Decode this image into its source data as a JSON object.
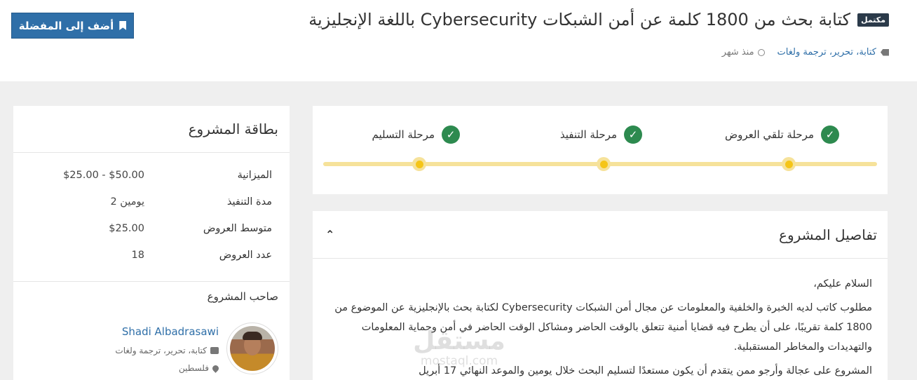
{
  "header": {
    "favorite_label": "أضف إلى المفضلة",
    "status": "مكتمل",
    "title": "كتابة بحث من 1800 كلمة عن أمن الشبكات Cybersecurity باللغة الإنجليزية",
    "categories": "كتابة، تحرير، ترجمة ولغات",
    "time": "منذ شهر"
  },
  "stages": [
    {
      "label": "مرحلة تلقي العروض"
    },
    {
      "label": "مرحلة التنفيذ"
    },
    {
      "label": "مرحلة التسليم"
    }
  ],
  "details": {
    "title": "تفاصيل المشروع",
    "paragraphs": [
      "السلام عليكم،",
      "مطلوب كاتب لديه الخبرة والخلفية والمعلومات عن مجال أمن الشبكات Cybersecurity لكتابة بحث بالإنجليزية عن الموضوع من 1800 كلمة تقريبًا، على أن يطرح فيه قضايا أمنية تتعلق بالوقت الحاضر ومشاكل الوقت الحاضر في أمن وحماية المعلومات والتهديدات والمخاطر المستقبلية.",
      "المشروع على عجالة وأرجو ممن يتقدم أن يكون مستعدًا لتسليم البحث خلال يومين والموعد النهائي 17 أبريل"
    ],
    "watermark_big": "مستقل",
    "watermark_small": "mostaql.com"
  },
  "project_card": {
    "title": "بطاقة المشروع",
    "stats": [
      {
        "label": "الميزانية",
        "value": "$25.00 - $50.00"
      },
      {
        "label": "مدة التنفيذ",
        "value": "2 يومين"
      },
      {
        "label": "متوسط العروض",
        "value": "$25.00"
      },
      {
        "label": "عدد العروض",
        "value": "18"
      }
    ],
    "owner_title": "صاحب المشروع",
    "owner_name": "Shadi Albadrasawi",
    "owner_categories": "كتابة، تحرير، ترجمة ولغات",
    "owner_location": "فلسطين"
  }
}
